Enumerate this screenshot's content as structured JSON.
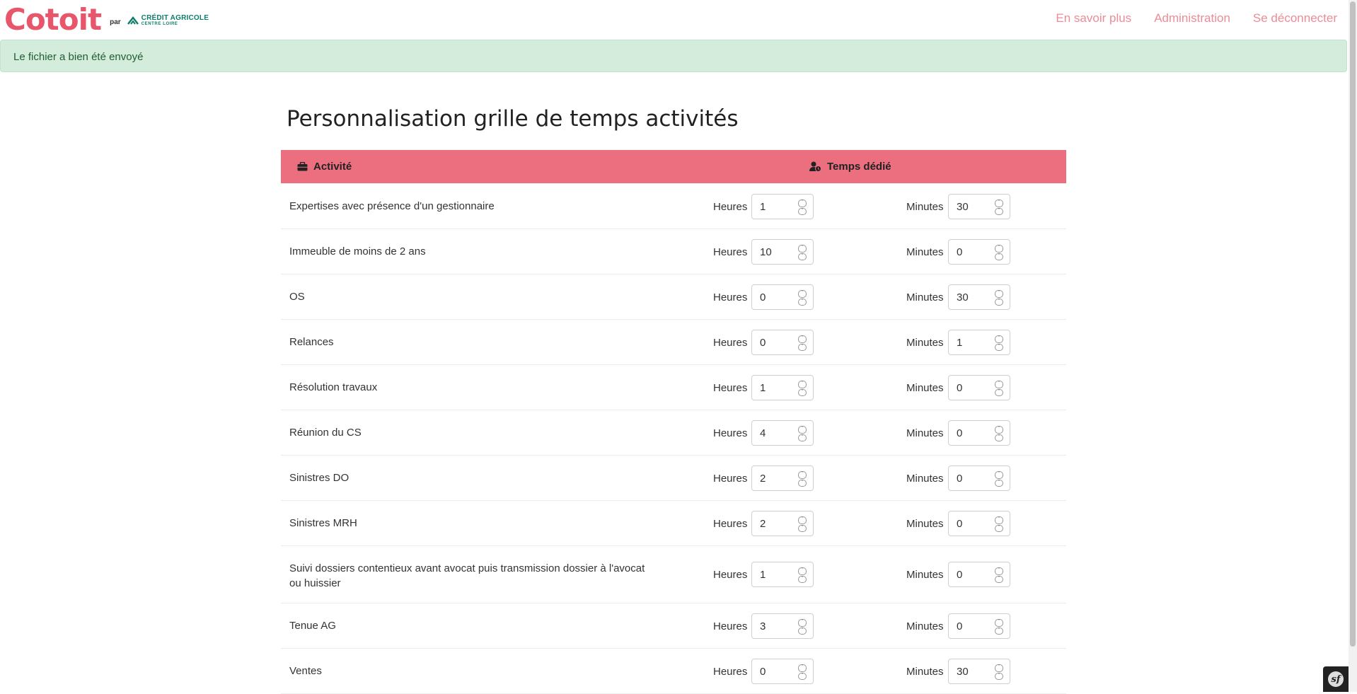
{
  "brand": {
    "logo_text": "Cotoit",
    "par": "par",
    "partner_line1": "CRÉDIT AGRICOLE",
    "partner_line2": "CENTRE LOIRE"
  },
  "nav": {
    "links": [
      {
        "label": "En savoir plus"
      },
      {
        "label": "Administration"
      },
      {
        "label": "Se déconnecter"
      }
    ]
  },
  "alert": {
    "message": "Le fichier a bien été envoyé"
  },
  "page": {
    "title": "Personnalisation grille de temps activités"
  },
  "table": {
    "headers": {
      "activite": "Activité",
      "temps": "Temps dédié"
    },
    "hours_label": "Heures",
    "minutes_label": "Minutes",
    "rows": [
      {
        "activity": "Expertises avec présence d'un gestionnaire",
        "hours": "1",
        "minutes": "30"
      },
      {
        "activity": "Immeuble de moins de 2 ans",
        "hours": "10",
        "minutes": "0"
      },
      {
        "activity": "OS",
        "hours": "0",
        "minutes": "30"
      },
      {
        "activity": "Relances",
        "hours": "0",
        "minutes": "1"
      },
      {
        "activity": "Résolution travaux",
        "hours": "1",
        "minutes": "0"
      },
      {
        "activity": "Réunion du CS",
        "hours": "4",
        "minutes": "0"
      },
      {
        "activity": "Sinistres DO",
        "hours": "2",
        "minutes": "0"
      },
      {
        "activity": "Sinistres MRH",
        "hours": "2",
        "minutes": "0"
      },
      {
        "activity": "Suivi dossiers contentieux avant avocat puis transmission dossier à l'avocat ou huissier",
        "hours": "1",
        "minutes": "0"
      },
      {
        "activity": "Tenue AG",
        "hours": "3",
        "minutes": "0"
      },
      {
        "activity": "Ventes",
        "hours": "0",
        "minutes": "30"
      }
    ]
  },
  "colors": {
    "brand_pink": "#e8566c",
    "header_bg": "#ec6f80",
    "nav_link": "#ec8c98",
    "alert_bg": "#d4ecdc",
    "alert_text": "#1f5e33",
    "partner_green": "#0d7c6a"
  },
  "icons": {
    "activite": "briefcase-icon",
    "temps": "user-clock-icon",
    "spin_up": "chevron-up-icon",
    "spin_down": "chevron-down-icon",
    "debug": "symfony-icon"
  }
}
